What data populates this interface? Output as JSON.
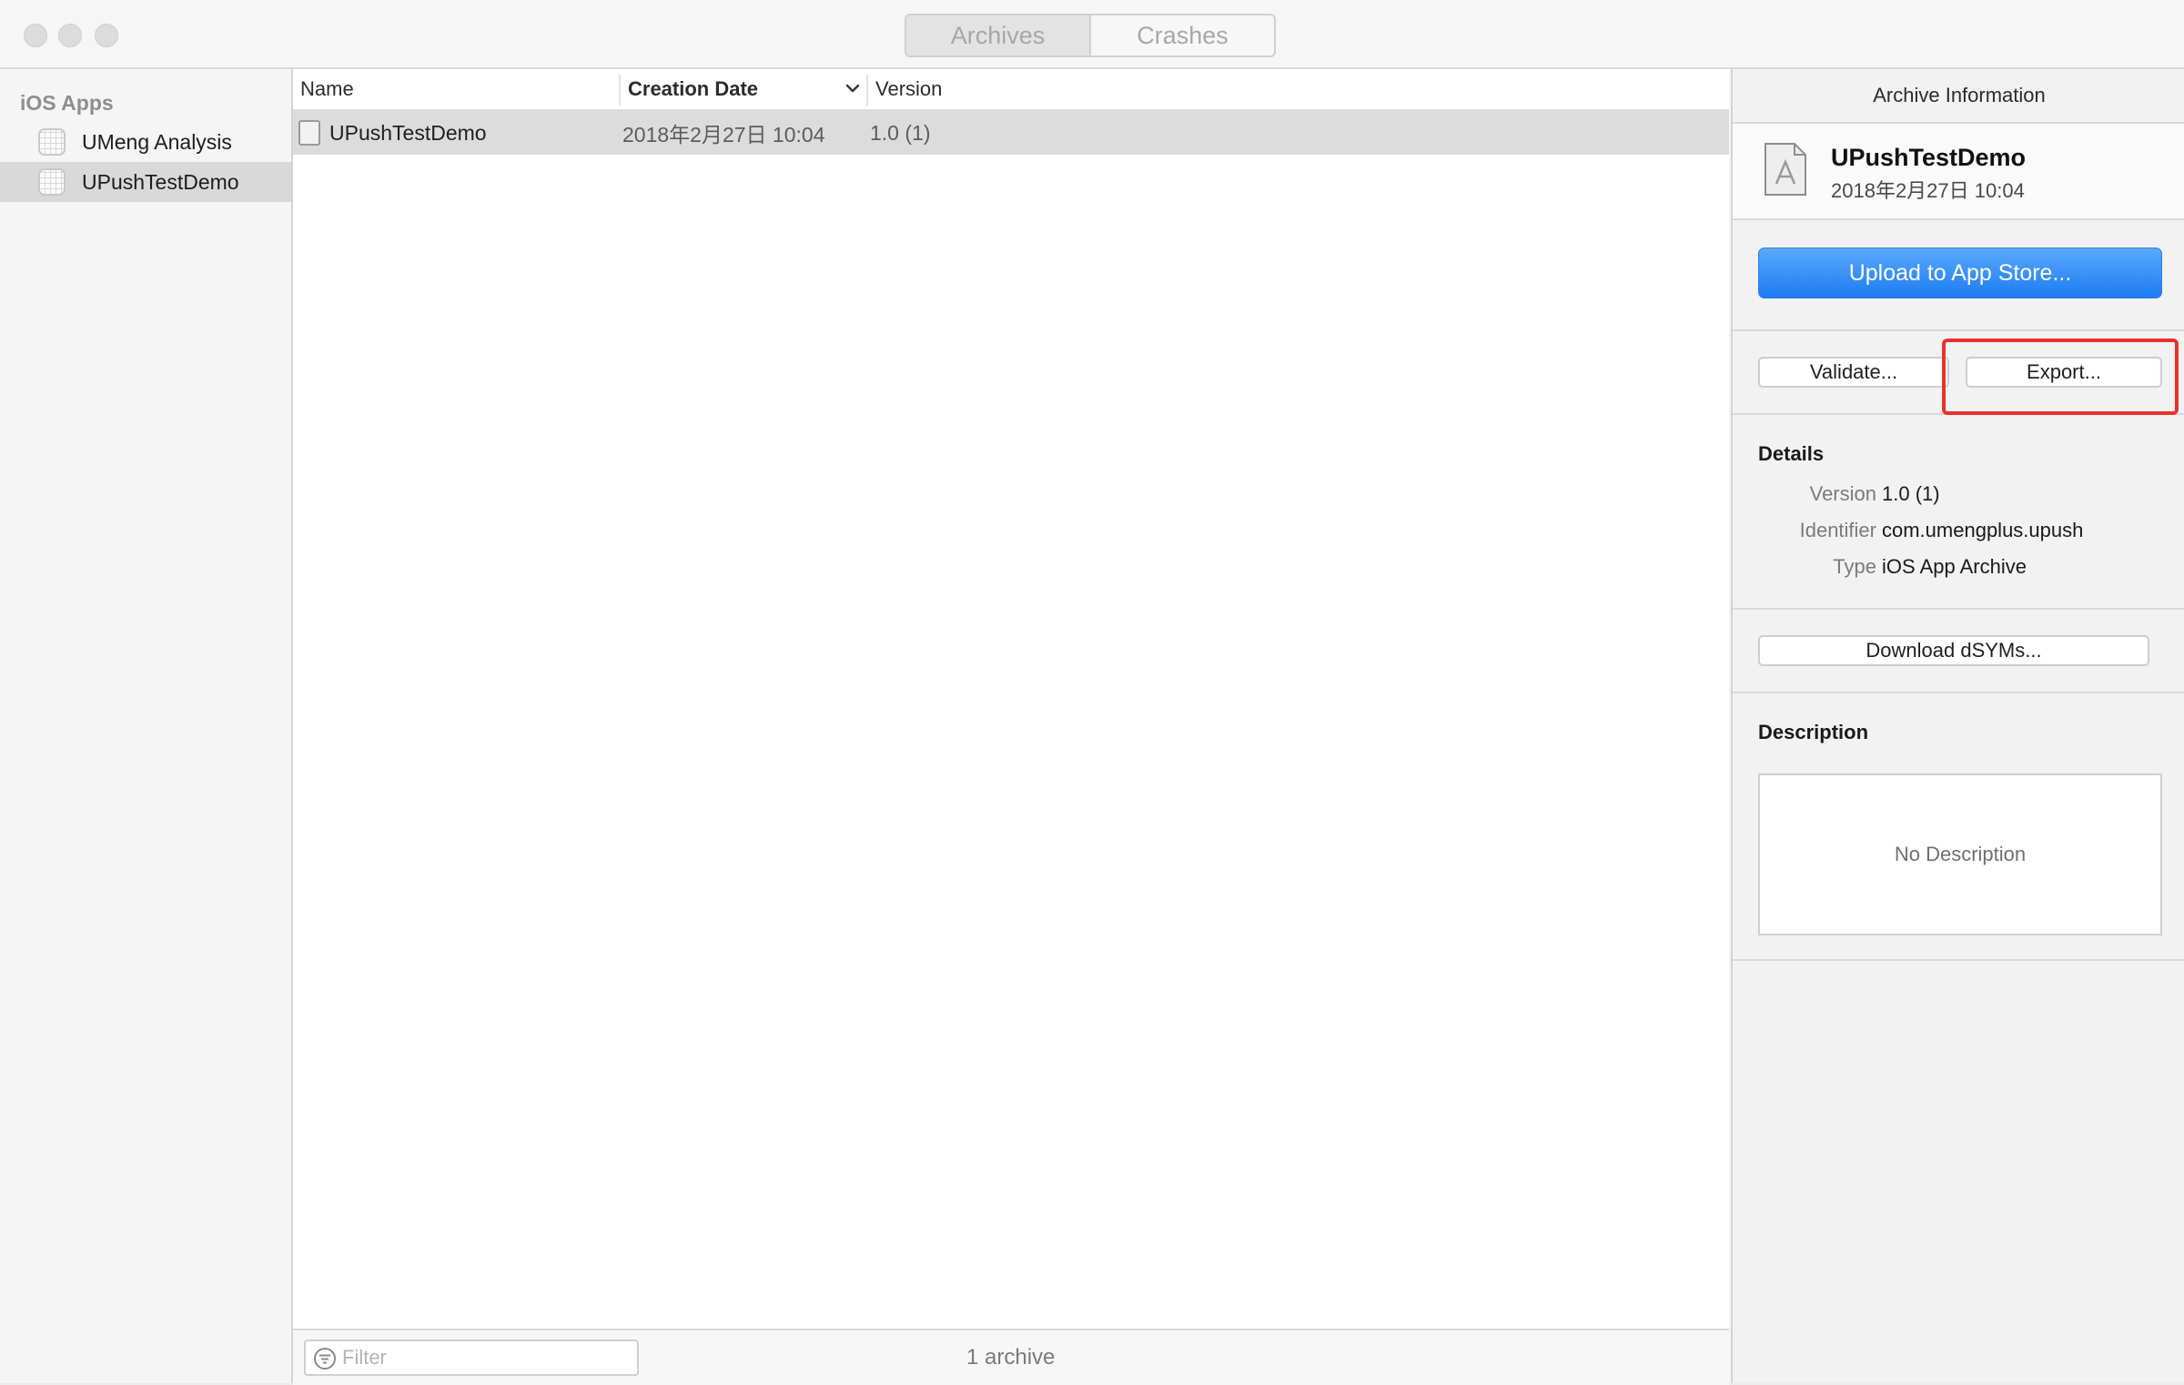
{
  "window": {
    "segmented": {
      "archives": "Archives",
      "crashes": "Crashes",
      "selected": "Archives"
    }
  },
  "sidebar": {
    "header": "iOS Apps",
    "items": [
      {
        "label": "UMeng Analysis",
        "selected": false
      },
      {
        "label": "UPushTestDemo",
        "selected": true
      }
    ]
  },
  "list": {
    "columns": {
      "name": "Name",
      "creation_date": "Creation Date",
      "version": "Version"
    },
    "rows": [
      {
        "name": "UPushTestDemo",
        "creation_date": "2018年2月27日 10:04",
        "version": "1.0 (1)"
      }
    ],
    "filter_placeholder": "Filter",
    "count_label": "1 archive"
  },
  "inspector": {
    "title": "Archive Information",
    "archive_name": "UPushTestDemo",
    "archive_date": "2018年2月27日 10:04",
    "upload_label": "Upload to App Store...",
    "validate_label": "Validate...",
    "export_label": "Export...",
    "details": {
      "title": "Details",
      "version_key": "Version",
      "version_val": "1.0 (1)",
      "identifier_key": "Identifier",
      "identifier_val": "com.umengplus.upush",
      "type_key": "Type",
      "type_val": "iOS App Archive"
    },
    "download_dsyms_label": "Download dSYMs...",
    "description": {
      "title": "Description",
      "placeholder": "No Description"
    }
  },
  "colors": {
    "accent": "#1d7bf3",
    "highlight_outline": "#e8322c",
    "selection": "#dcdcdc"
  }
}
